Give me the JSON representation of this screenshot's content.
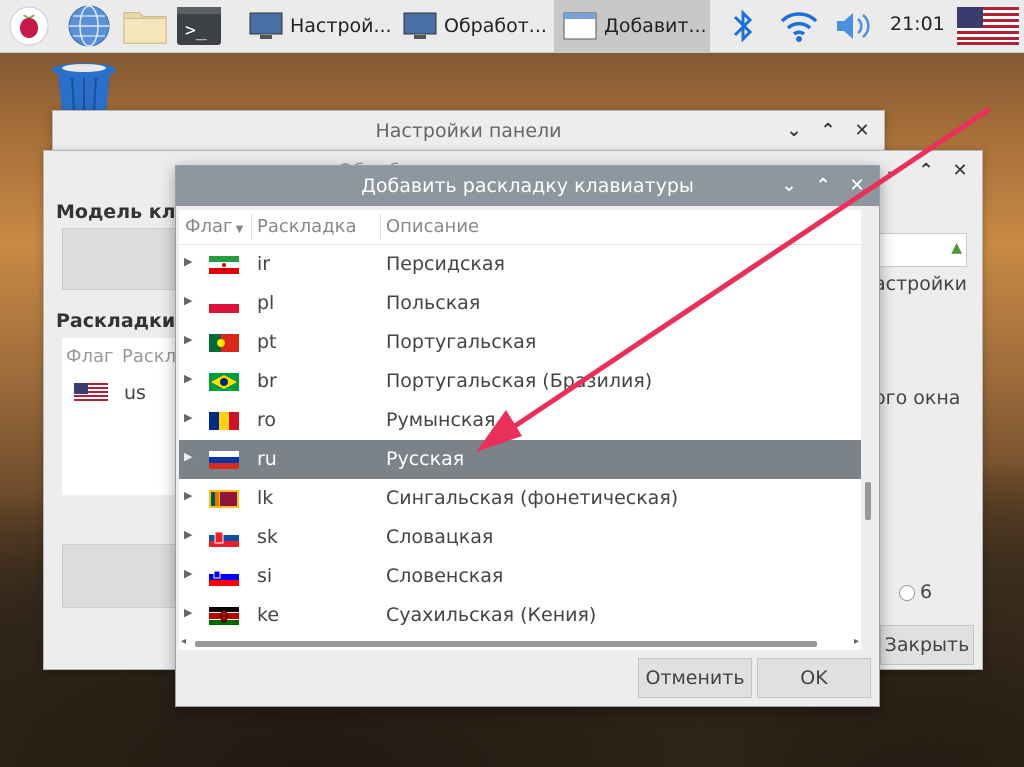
{
  "taskbar": {
    "tasks": [
      {
        "label": "Настрой..."
      },
      {
        "label": "Обработ..."
      },
      {
        "label": "Добавит..."
      }
    ],
    "clock": "21:01"
  },
  "bg_windows": {
    "panel_settings_title": "Настройки панели",
    "keyboard_title_partial": "Обработ",
    "model_label": "Модель кла",
    "layouts_label": "Раскладки к",
    "col_flag": "Флаг",
    "col_layout_partial": "Раскл",
    "us_code": "us",
    "settings_partial": "астройки",
    "window_partial": "ого окна",
    "radio_value": "6",
    "close_button": "Закрыть"
  },
  "dialog": {
    "title": "Добавить раскладку клавиатуры",
    "columns": {
      "flag": "Флаг",
      "layout": "Раскладка",
      "description": "Описание"
    },
    "rows": [
      {
        "code": "ir",
        "desc": "Персидская",
        "flag": "ir"
      },
      {
        "code": "pl",
        "desc": "Польская",
        "flag": "pl"
      },
      {
        "code": "pt",
        "desc": "Португальская",
        "flag": "pt"
      },
      {
        "code": "br",
        "desc": "Португальская (Бразилия)",
        "flag": "br"
      },
      {
        "code": "ro",
        "desc": "Румынская",
        "flag": "ro"
      },
      {
        "code": "ru",
        "desc": "Русская",
        "flag": "ru",
        "selected": true
      },
      {
        "code": "lk",
        "desc": "Сингальская (фонетическая)",
        "flag": "lk"
      },
      {
        "code": "sk",
        "desc": "Словацкая",
        "flag": "sk"
      },
      {
        "code": "si",
        "desc": "Словенская",
        "flag": "si"
      },
      {
        "code": "ke",
        "desc": "Суахильская (Кения)",
        "flag": "ke"
      }
    ],
    "cancel": "Отменить",
    "ok": "OK"
  },
  "colors": {
    "selection": "#7b8389",
    "titlebar": "#8e979f",
    "arrow": "#e8305a"
  }
}
